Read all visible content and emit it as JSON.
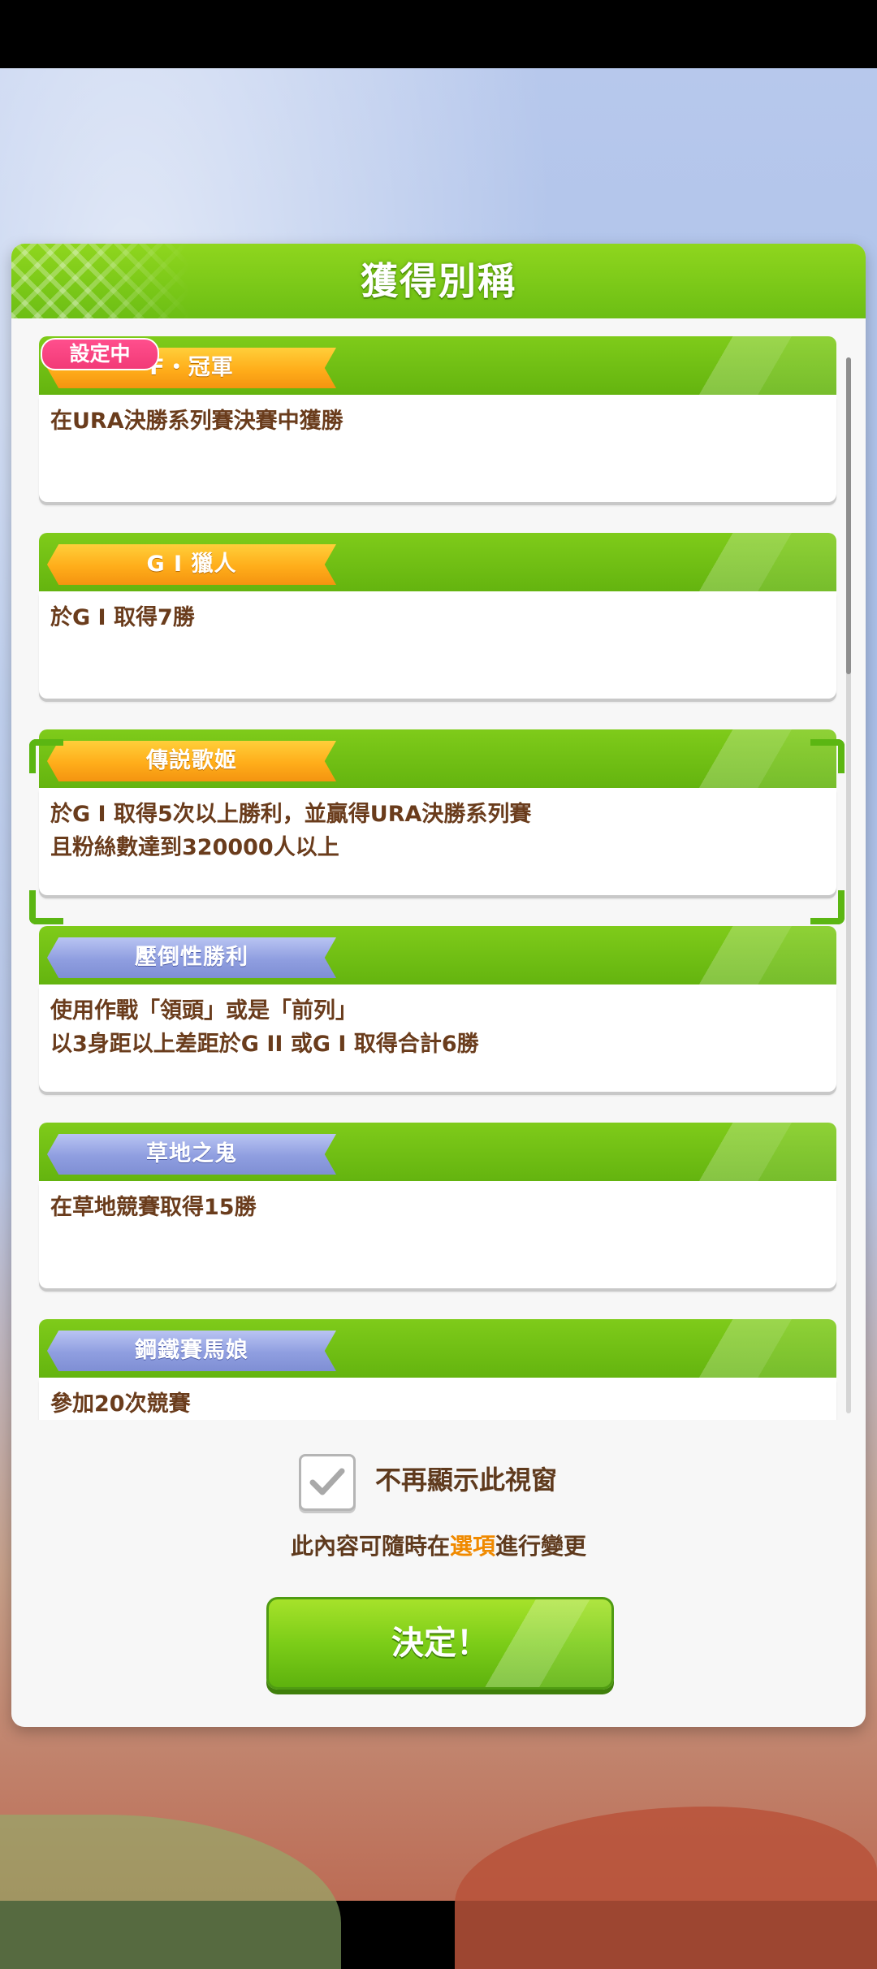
{
  "dialog": {
    "title": "獲得別稱",
    "setting_badge": "設定中",
    "titles": [
      {
        "name": "F・冠軍",
        "rank": "gold",
        "description": "在URA決勝系列賽決賽中獲勝",
        "selected": false
      },
      {
        "name": "G I 獵人",
        "rank": "gold",
        "description": "於G I 取得7勝",
        "selected": false
      },
      {
        "name": "傳説歌姬",
        "rank": "gold",
        "description": "於G I 取得5次以上勝利，並贏得URA決勝系列賽\n且粉絲數達到320000人以上",
        "selected": true
      },
      {
        "name": "壓倒性勝利",
        "rank": "silver",
        "description": "使用作戰「領頭」或是「前列」\n以3身距以上差距於G II 或G I 取得合計6勝",
        "selected": false
      },
      {
        "name": "草地之鬼",
        "rank": "silver",
        "description": "在草地競賽取得15勝",
        "selected": false
      },
      {
        "name": "鋼鐵賽馬娘",
        "rank": "silver",
        "description": "參加20次競賽",
        "selected": false
      }
    ],
    "dont_show_checkbox": {
      "label": "不再顯示此視窗",
      "checked": true
    },
    "note": {
      "before": "此內容可隨時在",
      "highlight": "選項",
      "after": "進行變更"
    },
    "confirm_button": "決定！"
  },
  "colors": {
    "accent_green": "#6cbe14",
    "ribbon_gold": "#ffad1a",
    "ribbon_silver": "#8f9ee0",
    "badge_pink": "#f23a77",
    "text_brown": "#6a3c1c",
    "highlight_orange": "#f08a00"
  }
}
